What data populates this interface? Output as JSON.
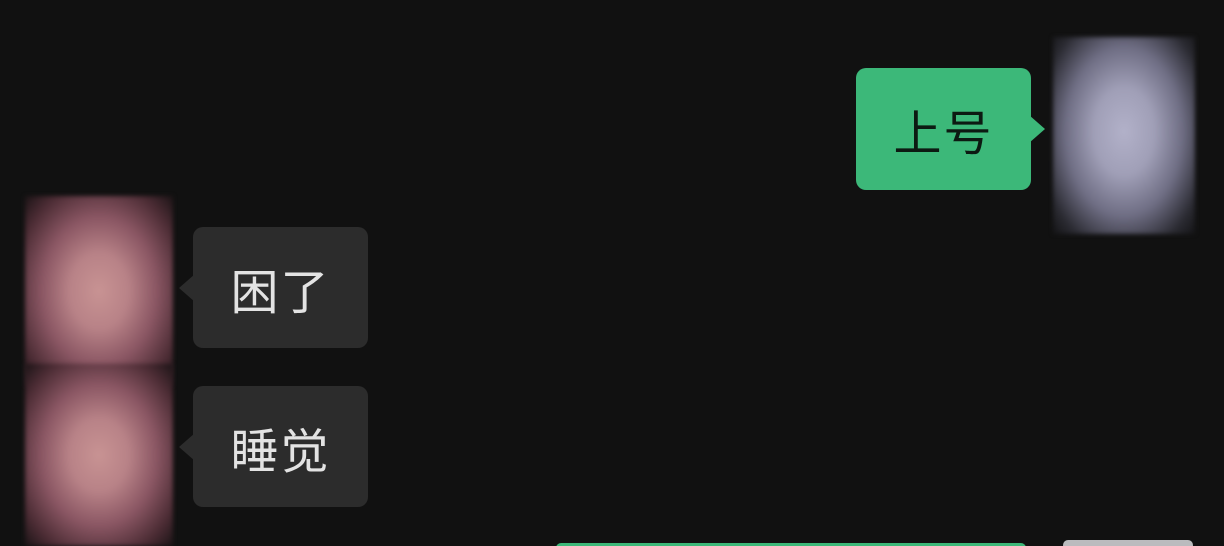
{
  "chat": {
    "messages": [
      {
        "sender": "self",
        "text": "上号"
      },
      {
        "sender": "other",
        "text": "困了"
      },
      {
        "sender": "other",
        "text": "睡觉"
      }
    ]
  },
  "colors": {
    "background": "#111111",
    "self_bubble": "#3cb879",
    "other_bubble": "#2c2c2c",
    "other_text": "#e3e3e3"
  }
}
